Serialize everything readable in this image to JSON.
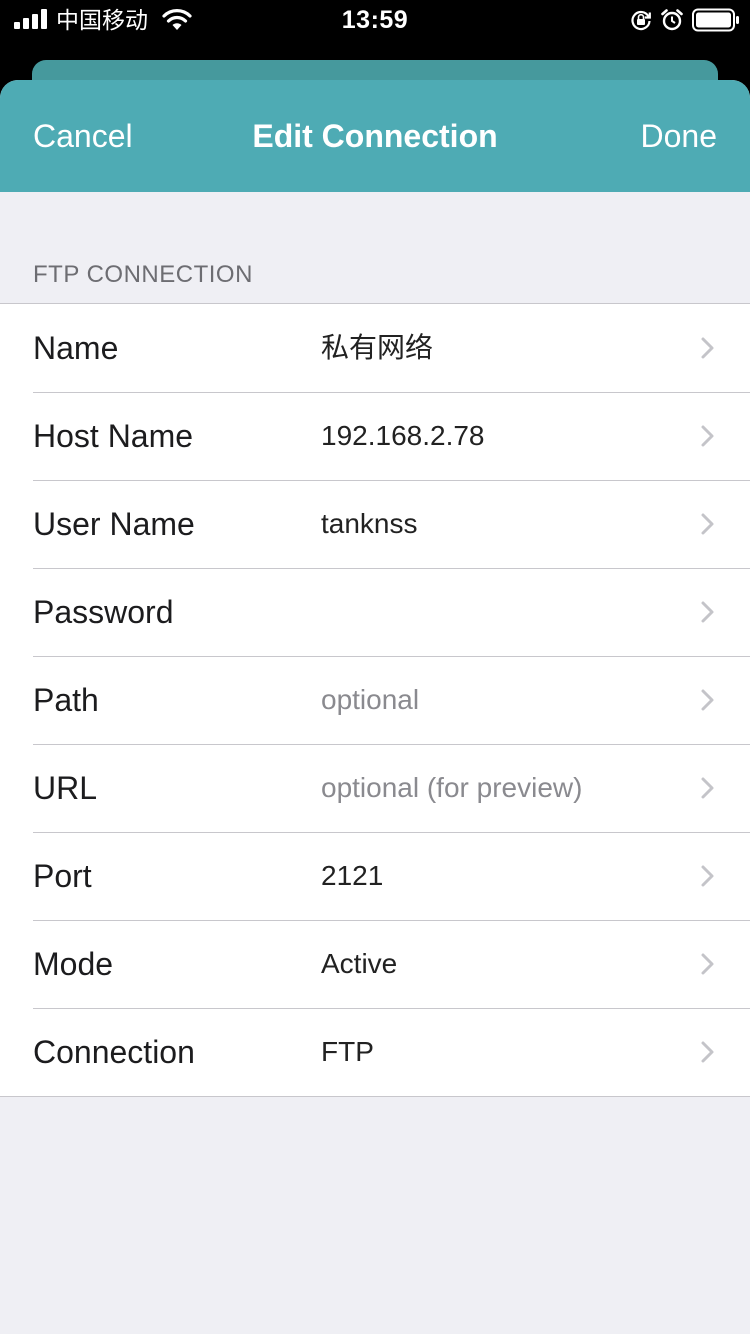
{
  "status_bar": {
    "carrier": "中国移动",
    "time": "13:59"
  },
  "nav": {
    "cancel_label": "Cancel",
    "title": "Edit Connection",
    "done_label": "Done"
  },
  "section": {
    "header": "FTP CONNECTION"
  },
  "rows": [
    {
      "label": "Name",
      "value": "私有网络",
      "placeholder": false
    },
    {
      "label": "Host Name",
      "value": "192.168.2.78",
      "placeholder": false
    },
    {
      "label": "User Name",
      "value": "tanknss",
      "placeholder": false
    },
    {
      "label": "Password",
      "value": "",
      "placeholder": false
    },
    {
      "label": "Path",
      "value": "optional",
      "placeholder": true
    },
    {
      "label": "URL",
      "value": "optional (for preview)",
      "placeholder": true
    },
    {
      "label": "Port",
      "value": "2121",
      "placeholder": false
    },
    {
      "label": "Mode",
      "value": "Active",
      "placeholder": false
    },
    {
      "label": "Connection",
      "value": "FTP",
      "placeholder": false
    }
  ],
  "icons": {
    "signal": "signal-bars-icon",
    "wifi": "wifi-icon",
    "rotation_lock": "rotation-lock-icon",
    "alarm": "alarm-icon",
    "battery": "battery-icon",
    "disclosure": "chevron-right-icon"
  },
  "colors": {
    "nav_bar": "#4eabb4",
    "back_sheet": "#46999d",
    "background": "#efeff4",
    "chevron": "#c4c4c9",
    "placeholder_text": "#8a8a8f"
  }
}
